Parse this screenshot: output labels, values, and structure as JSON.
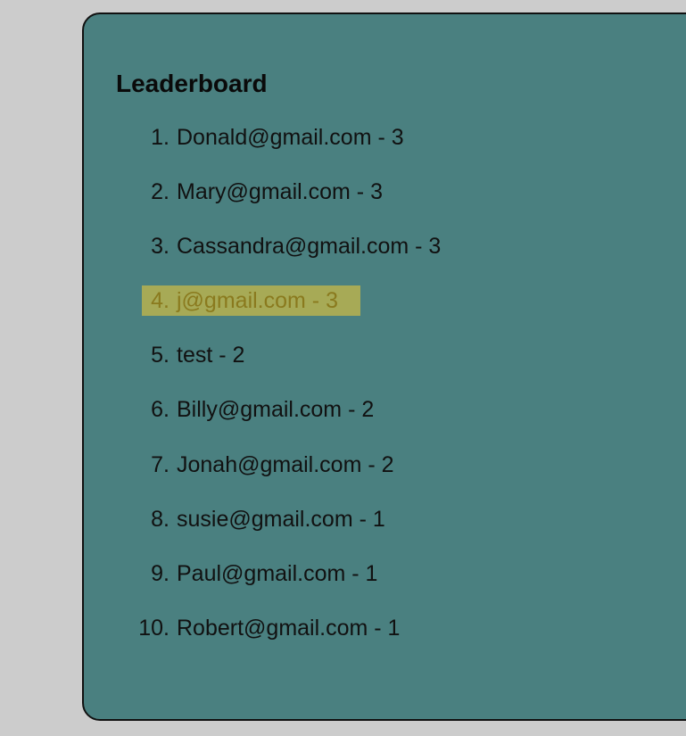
{
  "leaderboard": {
    "title": "Leaderboard",
    "highlight_color": "#b7b24f",
    "items": [
      {
        "rank": "1.",
        "text": "Donald@gmail.com - 3"
      },
      {
        "rank": "2.",
        "text": "Mary@gmail.com - 3"
      },
      {
        "rank": "3.",
        "text": "Cassandra@gmail.com - 3"
      },
      {
        "rank": "4.",
        "text": "j@gmail.com - 3"
      },
      {
        "rank": "5.",
        "text": "test - 2"
      },
      {
        "rank": "6.",
        "text": "Billy@gmail.com - 2"
      },
      {
        "rank": "7.",
        "text": "Jonah@gmail.com - 2"
      },
      {
        "rank": "8.",
        "text": "susie@gmail.com - 1"
      },
      {
        "rank": "9.",
        "text": "Paul@gmail.com - 1"
      },
      {
        "rank": "10.",
        "text": "Robert@gmail.com - 1"
      }
    ]
  }
}
